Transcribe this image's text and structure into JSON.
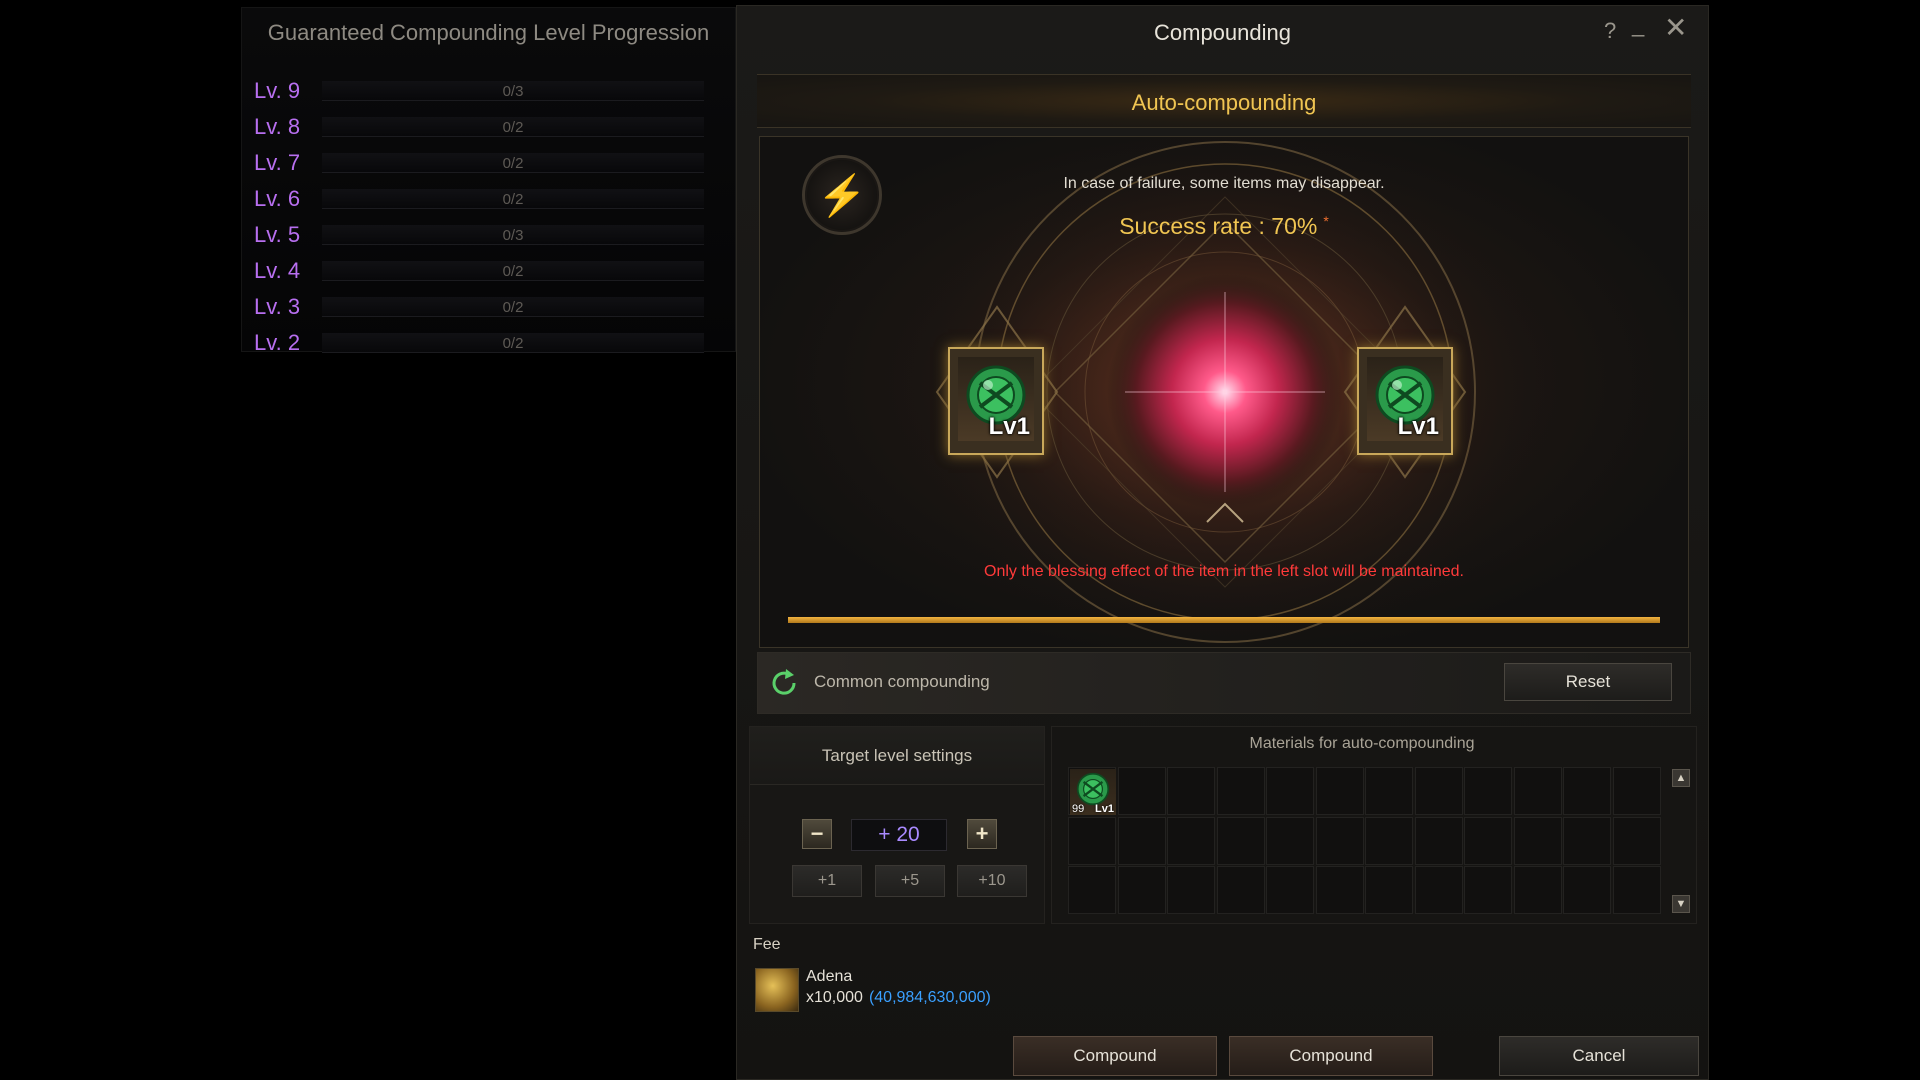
{
  "progression": {
    "title": "Guaranteed Compounding Level Progression",
    "rows": [
      {
        "level": "Lv. 9",
        "count": "0/3"
      },
      {
        "level": "Lv. 8",
        "count": "0/2"
      },
      {
        "level": "Lv. 7",
        "count": "0/2"
      },
      {
        "level": "Lv. 6",
        "count": "0/2"
      },
      {
        "level": "Lv. 5",
        "count": "0/3"
      },
      {
        "level": "Lv. 4",
        "count": "0/2"
      },
      {
        "level": "Lv. 3",
        "count": "0/2"
      },
      {
        "level": "Lv. 2",
        "count": "0/2"
      }
    ]
  },
  "window": {
    "title": "Compounding",
    "help_label": "?",
    "minimize_label": "_",
    "close_label": "✕"
  },
  "auto": {
    "title": "Auto-compounding",
    "bolt_glyph": "⚡",
    "fail_text": "In case of failure, some items may disappear.",
    "success_rate": "Success rate : 70%",
    "rate_star": "*",
    "warning": "Only the blessing effect of the item in the left slot will be maintained.",
    "left_slot_level": "Lv1",
    "right_slot_level": "Lv1"
  },
  "common": {
    "label": "Common compounding",
    "reset_label": "Reset"
  },
  "target": {
    "title": "Target level settings",
    "minus_label": "−",
    "plus_label": "+",
    "value": "+ 20",
    "quick": [
      "+1",
      "+5",
      "+10"
    ]
  },
  "materials": {
    "title": "Materials for auto-compounding",
    "scroll_up": "▲",
    "scroll_down": "▼",
    "first_item_count": "99",
    "first_item_level": "Lv1"
  },
  "fee": {
    "label": "Fee",
    "currency": "Adena",
    "amount": "x10,000",
    "balance": "(40,984,630,000)"
  },
  "buttons": {
    "compound_1": "Compound",
    "compound_2": "Compound",
    "cancel": "Cancel"
  },
  "colors": {
    "level_purple": "#b86ff0",
    "gold": "#f0c552",
    "warning_red": "#ff3a3a",
    "balance_blue": "#3aa0ff"
  },
  "icons": {
    "slot_item": "green-gem-icon",
    "common": "refresh-icon",
    "fee": "adena-coin-icon",
    "bolt": "lightning-icon"
  }
}
